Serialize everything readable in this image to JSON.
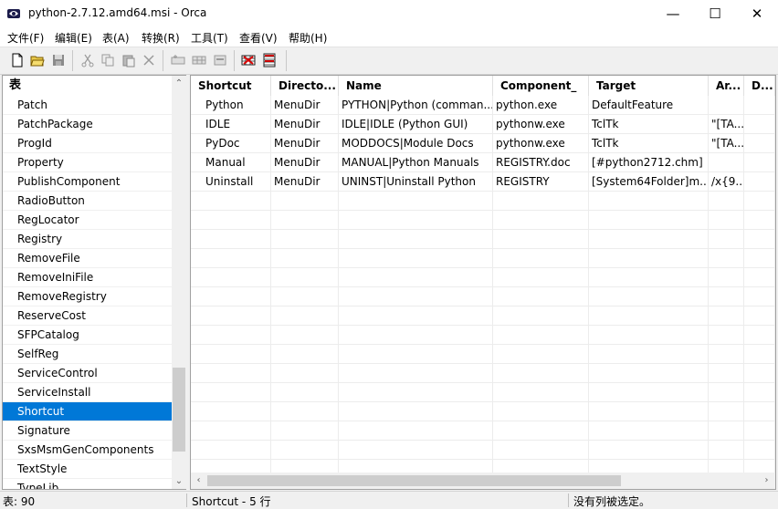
{
  "window": {
    "title": "python-2.7.12.amd64.msi - Orca"
  },
  "menu": [
    "文件(F)",
    "编辑(E)",
    "表(A)",
    "转换(R)",
    "工具(T)",
    "查看(V)",
    "帮助(H)"
  ],
  "toolbar": {
    "icons": [
      "new-file-icon",
      "open-folder-icon",
      "save-icon",
      "cut-icon",
      "copy-icon",
      "paste-icon",
      "delete-icon",
      "add-row-icon",
      "table-icon",
      "properties-icon",
      "validate-icon",
      "tables-icon"
    ]
  },
  "tables_pane": {
    "header": "表",
    "items": [
      "Patch",
      "PatchPackage",
      "ProgId",
      "Property",
      "PublishComponent",
      "RadioButton",
      "RegLocator",
      "Registry",
      "RemoveFile",
      "RemoveIniFile",
      "RemoveRegistry",
      "ReserveCost",
      "SFPCatalog",
      "SelfReg",
      "ServiceControl",
      "ServiceInstall",
      "Shortcut",
      "Signature",
      "SxsMsmGenComponents",
      "TextStyle",
      "TypeLib"
    ],
    "selected": "Shortcut"
  },
  "grid": {
    "columns": [
      "Shortcut",
      "Directo...",
      "Name",
      "Component_",
      "Target",
      "Ar...",
      "D..."
    ],
    "rows": [
      [
        "Python",
        "MenuDir",
        "PYTHON|Python (comman...",
        "python.exe",
        "DefaultFeature",
        "",
        ""
      ],
      [
        "IDLE",
        "MenuDir",
        "IDLE|IDLE (Python GUI)",
        "pythonw.exe",
        "TclTk",
        "\"[TA...",
        ""
      ],
      [
        "PyDoc",
        "MenuDir",
        "MODDOCS|Module Docs",
        "pythonw.exe",
        "TclTk",
        "\"[TA...",
        ""
      ],
      [
        "Manual",
        "MenuDir",
        "MANUAL|Python Manuals",
        "REGISTRY.doc",
        "[#python2712.chm]",
        "",
        ""
      ],
      [
        "Uninstall",
        "MenuDir",
        "UNINST|Uninstall Python",
        "REGISTRY",
        "[System64Folder]m...",
        "/x{9...",
        ""
      ]
    ]
  },
  "status": {
    "table_count": "表: 90",
    "current": "Shortcut - 5 行",
    "selection": "没有列被选定。"
  }
}
